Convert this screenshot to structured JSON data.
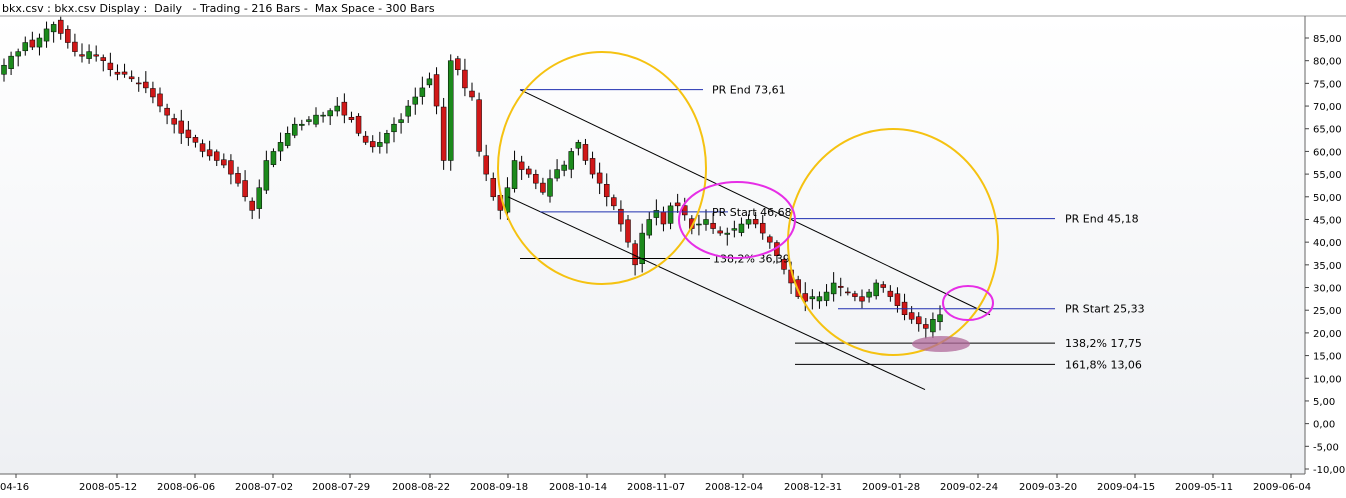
{
  "header": {
    "title": "bkx.csv : bkx.csv Display :  Daily   - Trading - 216 Bars -  Max Space - 300 Bars"
  },
  "colors": {
    "up_candle": "#1c8a1c",
    "down_candle": "#d01818",
    "wick": "#000000",
    "channel_line": "#000000",
    "level_line": "#1f2fb0",
    "fib_line": "#000000",
    "yellow_circle": "#f5c211",
    "magenta_ellipse": "#e62ee6",
    "target_ellipse": "#b06a9a",
    "grid": "#d8d8d8"
  },
  "chart_data": {
    "type": "candlestick",
    "title": "",
    "xlabel": "",
    "ylabel": "",
    "ylim": [
      -10,
      88
    ],
    "y_ticks": [
      "-10,00",
      "-5,00",
      "0,00",
      "5,00",
      "10,00",
      "15,00",
      "20,00",
      "25,00",
      "30,00",
      "35,00",
      "40,00",
      "45,00",
      "50,00",
      "55,00",
      "60,00",
      "65,00",
      "70,00",
      "75,00",
      "80,00",
      "85,00"
    ],
    "x_ticks": [
      "04-16",
      "2008-05-12",
      "2008-06-06",
      "2008-07-02",
      "2008-07-29",
      "2008-08-22",
      "2008-09-18",
      "2008-10-14",
      "2008-11-07",
      "2008-12-04",
      "2008-12-31",
      "2009-01-28",
      "2009-02-24",
      "2009-03-20",
      "2009-04-15",
      "2009-05-11",
      "2009-06-04"
    ],
    "grid": true,
    "levels": [
      {
        "label": "PR End 73,61",
        "value": 73.61
      },
      {
        "label": "PR Start 46,68",
        "value": 46.68
      },
      {
        "label": "138,2% 36,39",
        "value": 36.39
      },
      {
        "label": "PR End 45,18",
        "value": 45.18
      },
      {
        "label": "PR Start 25,33",
        "value": 25.33
      },
      {
        "label": "138,2% 17,75",
        "value": 17.75
      },
      {
        "label": "161,8% 13,06",
        "value": 13.06
      }
    ],
    "candles_close": [
      79,
      81,
      82,
      84,
      83,
      85,
      87,
      88,
      86,
      84,
      82,
      81,
      82,
      81,
      80,
      78,
      77,
      77,
      76,
      75,
      74,
      72,
      70,
      68,
      66,
      64,
      63,
      62,
      60,
      59,
      58,
      57,
      55,
      53,
      50,
      47,
      52,
      58,
      60,
      62,
      64,
      66,
      66,
      67,
      68,
      68,
      69,
      70,
      68,
      67,
      64,
      62,
      61,
      62,
      64,
      66,
      67,
      70,
      72,
      74,
      76,
      70,
      58,
      80,
      78,
      74,
      72,
      60,
      55,
      50,
      47,
      52,
      58,
      56,
      55,
      53,
      51,
      54,
      56,
      57,
      60,
      62,
      58,
      55,
      53,
      50,
      48,
      44,
      40,
      35,
      42,
      45,
      47,
      44,
      48,
      48,
      46,
      43,
      44,
      45,
      43,
      42,
      42,
      43,
      44,
      45,
      44,
      42,
      40,
      37,
      34,
      31,
      28,
      27,
      28,
      28,
      29,
      31,
      30,
      29,
      28,
      27,
      29,
      31,
      30,
      28,
      26,
      24,
      23,
      22,
      21,
      23,
      24
    ]
  }
}
